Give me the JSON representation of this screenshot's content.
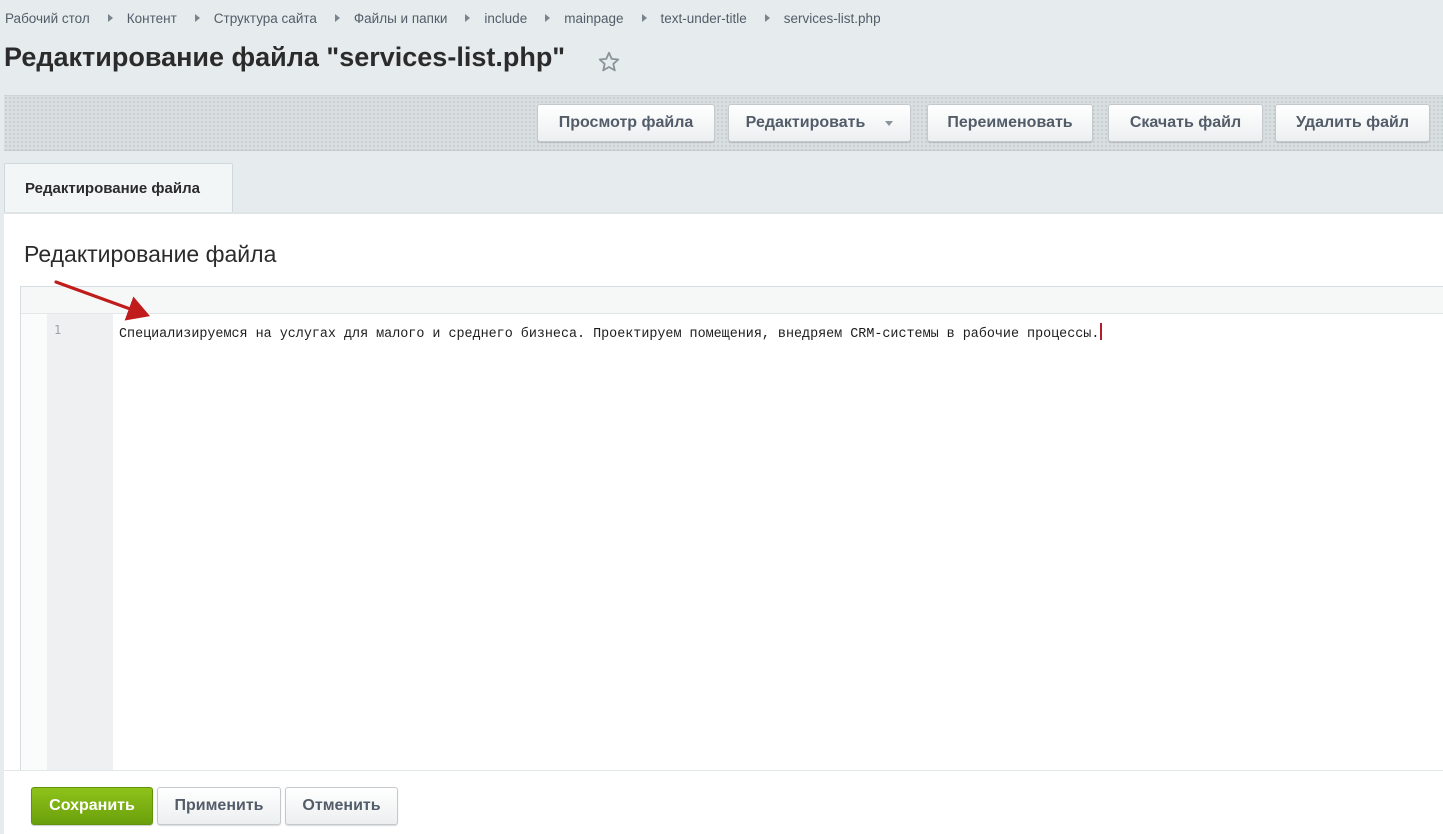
{
  "breadcrumb": {
    "items": [
      "Рабочий стол",
      "Контент",
      "Структура сайта",
      "Файлы и папки",
      "include",
      "mainpage",
      "text-under-title",
      "services-list.php"
    ]
  },
  "page_title": "Редактирование файла \"services-list.php\"",
  "toolbar": {
    "view_label": "Просмотр файла",
    "edit_label": "Редактировать",
    "rename_label": "Переименовать",
    "download_label": "Скачать файл",
    "delete_label": "Удалить файл"
  },
  "tabs": [
    {
      "label": "Редактирование файла"
    }
  ],
  "section_title": "Редактирование файла",
  "editor": {
    "line_number": "1",
    "line_text": "Специализируемся на услугах для малого и среднего бизнеса. Проектируем помещения, внедряем CRM-системы в рабочие процессы."
  },
  "footer": {
    "save_label": "Сохранить",
    "apply_label": "Применить",
    "cancel_label": "Отменить"
  },
  "colors": {
    "accent_green": "#7cb514",
    "annotation_arrow": "#c01c1c",
    "cursor": "#b01e2a"
  },
  "icons": {
    "star": "star-icon",
    "breadcrumb_separator": "chevron-right-icon",
    "dropdown": "caret-down-icon"
  }
}
